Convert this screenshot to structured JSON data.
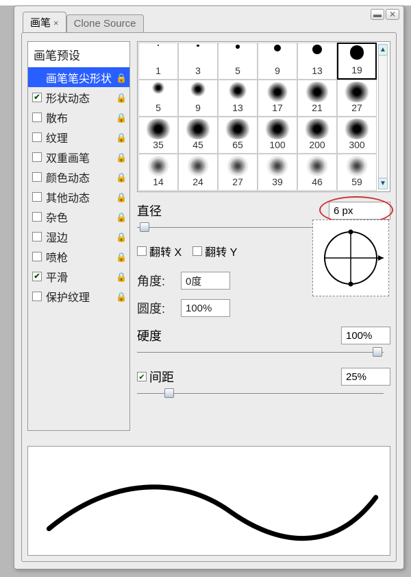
{
  "tabs": {
    "brush": "画笔",
    "clone": "Clone Source"
  },
  "sidebar": {
    "head": "画笔预设",
    "items": [
      {
        "label": "画笔笔尖形状",
        "checked": false,
        "lock": true,
        "selected": true
      },
      {
        "label": "形状动态",
        "checked": true,
        "lock": true
      },
      {
        "label": "散布",
        "checked": false,
        "lock": true
      },
      {
        "label": "纹理",
        "checked": false,
        "lock": true
      },
      {
        "label": "双重画笔",
        "checked": false,
        "lock": true
      },
      {
        "label": "颜色动态",
        "checked": false,
        "lock": true
      },
      {
        "label": "其他动态",
        "checked": false,
        "lock": true
      },
      {
        "label": "杂色",
        "checked": false,
        "lock": true
      },
      {
        "label": "湿边",
        "checked": false,
        "lock": true
      },
      {
        "label": "喷枪",
        "checked": false,
        "lock": true
      },
      {
        "label": "平滑",
        "checked": true,
        "lock": true
      },
      {
        "label": "保护纹理",
        "checked": false,
        "lock": true
      }
    ]
  },
  "brush_sizes": {
    "row1": [
      1,
      3,
      5,
      9,
      13,
      19
    ],
    "sel1": 19,
    "row2": [
      5,
      9,
      13,
      17,
      21,
      27
    ],
    "row3": [
      35,
      45,
      65,
      100,
      200,
      300
    ],
    "row4": [
      14,
      24,
      27,
      39,
      46,
      59
    ]
  },
  "labels": {
    "diameter": "直径",
    "diameter_val": "6 px",
    "flipx": "翻转 X",
    "flipy": "翻转 Y",
    "angle": "角度:",
    "angle_val": "0度",
    "roundness": "圆度:",
    "roundness_val": "100%",
    "hardness": "硬度",
    "hardness_val": "100%",
    "spacing": "间距",
    "spacing_val": "25%",
    "spacing_checked": true
  }
}
